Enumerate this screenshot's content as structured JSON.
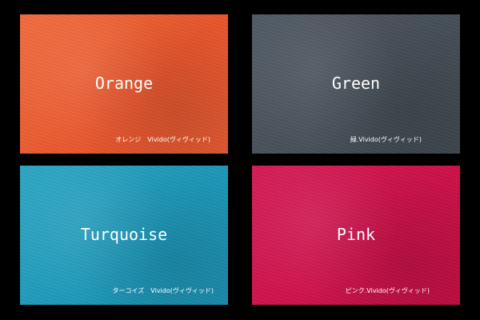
{
  "swatches": [
    {
      "name": "Orange",
      "caption": "オレンジ　Vivido(ヴィヴィッド)",
      "color": "#e8552c"
    },
    {
      "name": "Green",
      "caption": "緑.Vivido(ヴィヴィッド)",
      "color": "#454e57"
    },
    {
      "name": "Turquoise",
      "caption": "ターコイズ　Vivido(ヴィヴィッド)",
      "color": "#1c97b8"
    },
    {
      "name": "Pink",
      "caption": "ピンク.Vivido(ヴィヴィッド)",
      "color": "#cc1048"
    }
  ]
}
